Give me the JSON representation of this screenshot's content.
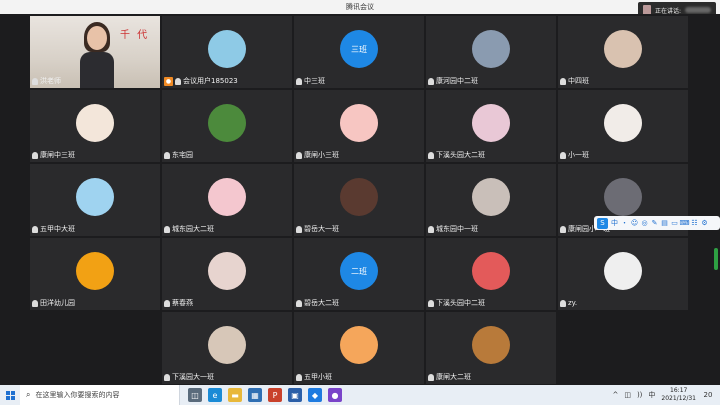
{
  "window": {
    "title": "腾讯会议",
    "speaking_label": "正在讲话:"
  },
  "tiles": [
    {
      "name": "洪老师",
      "kind": "video",
      "col": 0,
      "row": 0,
      "video_text": "千 代"
    },
    {
      "name": "会议用户185023",
      "kind": "avatar",
      "col": 1,
      "row": 0,
      "avatar_color": "#8ecae6",
      "user_icon": true
    },
    {
      "name": "中三班",
      "kind": "avatar",
      "col": 2,
      "row": 0,
      "avatar_color": "#1e88e5",
      "avatar_text": "三班"
    },
    {
      "name": "康河园中二班",
      "kind": "avatar",
      "col": 3,
      "row": 0,
      "avatar_color": "#8a9bb0"
    },
    {
      "name": "中四班",
      "kind": "avatar",
      "col": 4,
      "row": 0,
      "avatar_color": "#d9c2b0"
    },
    {
      "name": "康闸中三班",
      "kind": "avatar",
      "col": 0,
      "row": 1,
      "avatar_color": "#f3e6da"
    },
    {
      "name": "东宅园",
      "kind": "avatar",
      "col": 1,
      "row": 1,
      "avatar_color": "#4c8a3c"
    },
    {
      "name": "康闸小三班",
      "kind": "avatar",
      "col": 2,
      "row": 1,
      "avatar_color": "#f7c6c2"
    },
    {
      "name": "下溪头园大二班",
      "kind": "avatar",
      "col": 3,
      "row": 1,
      "avatar_color": "#e9c8d6"
    },
    {
      "name": "小一班",
      "kind": "avatar",
      "col": 4,
      "row": 1,
      "avatar_color": "#f1ece8"
    },
    {
      "name": "五甲中大班",
      "kind": "avatar",
      "col": 0,
      "row": 2,
      "avatar_color": "#9fd3f0"
    },
    {
      "name": "城东园大二班",
      "kind": "avatar",
      "col": 1,
      "row": 2,
      "avatar_color": "#f4c7cf"
    },
    {
      "name": "碧岳大一班",
      "kind": "avatar",
      "col": 2,
      "row": 2,
      "avatar_color": "#5a3a30"
    },
    {
      "name": "城东园中一班",
      "kind": "avatar",
      "col": 3,
      "row": 2,
      "avatar_color": "#c9bfb9"
    },
    {
      "name": "康闸园小一班",
      "kind": "avatar",
      "col": 4,
      "row": 2,
      "avatar_color": "#6c6c74"
    },
    {
      "name": "田洋幼儿园",
      "kind": "avatar",
      "col": 0,
      "row": 3,
      "avatar_color": "#f2a114"
    },
    {
      "name": "蔡春燕",
      "kind": "avatar",
      "col": 1,
      "row": 3,
      "avatar_color": "#e7d4cf"
    },
    {
      "name": "碧岳大二班",
      "kind": "avatar",
      "col": 2,
      "row": 3,
      "avatar_color": "#1e88e5",
      "avatar_text": "二班"
    },
    {
      "name": "下溪头园中二班",
      "kind": "avatar",
      "col": 3,
      "row": 3,
      "avatar_color": "#e35a5a"
    },
    {
      "name": "zy.",
      "kind": "avatar",
      "col": 4,
      "row": 3,
      "avatar_color": "#efefef"
    },
    {
      "name": "下溪园大一班",
      "kind": "avatar",
      "col": 1,
      "row": 4,
      "avatar_color": "#d7c7b8"
    },
    {
      "name": "五甲小班",
      "kind": "avatar",
      "col": 2,
      "row": 4,
      "avatar_color": "#f5a65b"
    },
    {
      "name": "康闸大二班",
      "kind": "avatar",
      "col": 3,
      "row": 4,
      "avatar_color": "#b87a3a"
    }
  ],
  "float_toolbar": {
    "badge": "S",
    "items": [
      "中",
      "・",
      "☺",
      "◎",
      "✎",
      "▤",
      "▭",
      "⌨",
      "☷",
      "⚙"
    ]
  },
  "taskbar": {
    "search_placeholder": "在这里输入你要搜索的内容",
    "search_icon": "magnifier-icon",
    "apps": [
      {
        "name": "task-view-icon",
        "glyph": "◫",
        "color": "#5a6b7c"
      },
      {
        "name": "edge-icon",
        "glyph": "e",
        "color": "#1a8bd6"
      },
      {
        "name": "explorer-icon",
        "glyph": "▬",
        "color": "#e8b83a"
      },
      {
        "name": "store-icon",
        "glyph": "▦",
        "color": "#2f6fb3"
      },
      {
        "name": "powerpoint-icon",
        "glyph": "P",
        "color": "#c9412b"
      },
      {
        "name": "app-icon",
        "glyph": "▣",
        "color": "#2b5fa8"
      },
      {
        "name": "meeting-icon",
        "glyph": "◆",
        "color": "#1e7be0"
      },
      {
        "name": "media-icon",
        "glyph": "●",
        "color": "#7a44c9"
      }
    ],
    "tray": [
      "^",
      "◫",
      "))",
      "中"
    ],
    "time": "16:17",
    "date": "2021/12/31",
    "notif_count": "20"
  }
}
